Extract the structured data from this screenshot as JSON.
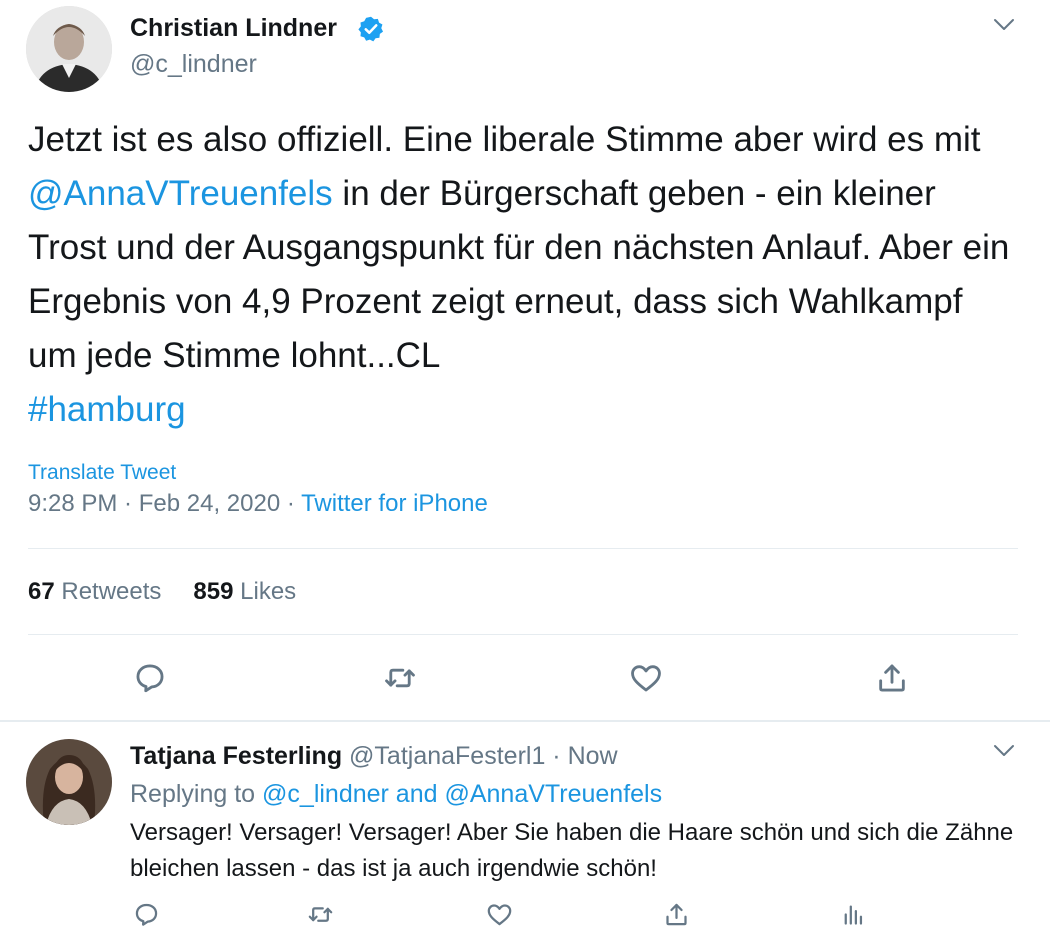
{
  "tweet": {
    "author_name": "Christian Lindner",
    "handle": "@c_lindner",
    "verified_icon": "verified-badge-icon",
    "text_part1": "Jetzt ist es also offiziell. Eine liberale Stimme aber wird es mit ",
    "mention": "@AnnaVTreuenfels",
    "text_part2": " in der Bürgerschaft geben - ein kleiner Trost und der Ausgangspunkt für den nächsten Anlauf. Aber ein Ergebnis von 4,9 Prozent zeigt erneut, dass sich Wahlkampf um jede Stimme lohnt...CL",
    "hashtag": "#hamburg",
    "translate_label": "Translate Tweet",
    "time": "9:28 PM",
    "date": "Feb 24, 2020",
    "separator": " · ",
    "source": "Twitter for iPhone",
    "retweets_count": "67",
    "retweets_label": "Retweets",
    "likes_count": "859",
    "likes_label": "Likes"
  },
  "reply": {
    "author_name": "Tatjana Festerling",
    "handle": "@TatjanaFesterl1",
    "time_separator": " · ",
    "time": "Now",
    "replying_prefix": "Replying to ",
    "replying_to": "@c_lindner and @AnnaVTreuenfels",
    "text": "Versager! Versager! Versager! Aber Sie haben die Haare schön und sich die Zähne bleichen lassen - das ist ja auch irgendwie schön!"
  },
  "colors": {
    "link": "#1b95e0",
    "secondary_text": "#657786",
    "primary_text": "#14171a",
    "divider": "#e6ecf0"
  },
  "icons": [
    "reply-icon",
    "retweet-icon",
    "like-icon",
    "share-icon",
    "analytics-icon",
    "chevron-down-icon",
    "verified-badge-icon"
  ]
}
